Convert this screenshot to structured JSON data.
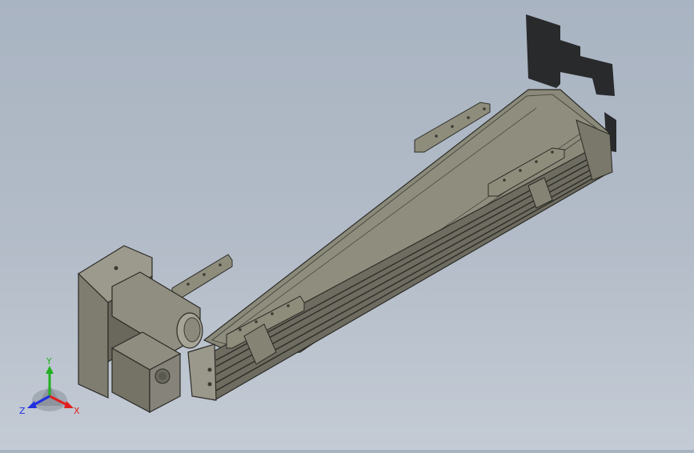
{
  "viewport": {
    "background_top": "#a9b4c2",
    "background_bottom": "#c4cbd5",
    "model_color": "#8e8c7b",
    "shadow_color": "#1a1a1a"
  },
  "triad": {
    "x_label": "X",
    "y_label": "Y",
    "z_label": "Z",
    "x_color": "#e02020",
    "y_color": "#20b020",
    "z_color": "#2030e0"
  }
}
